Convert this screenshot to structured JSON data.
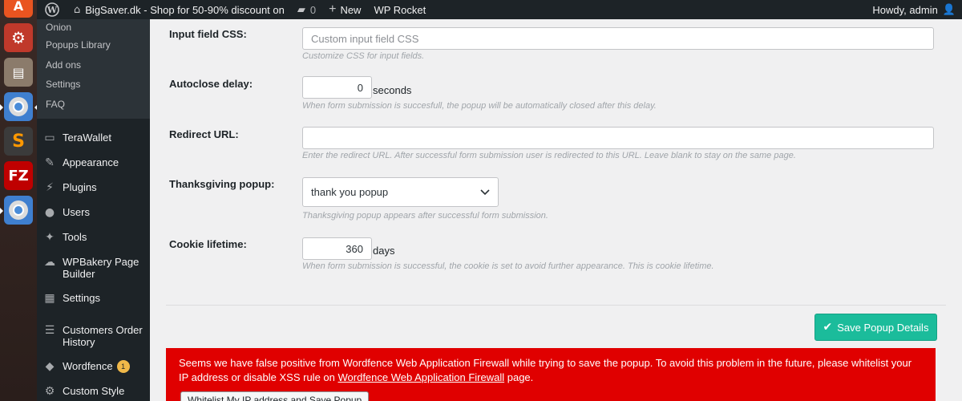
{
  "adminbar": {
    "site_name": "BigSaver.dk - Shop for 50-90% discount on",
    "comments_count": "0",
    "new_label": "New",
    "wp_rocket_label": "WP Rocket",
    "howdy": "Howdy, admin"
  },
  "sidebar": {
    "submenu": [
      "Onion",
      "Popups Library",
      "Add ons",
      "Settings",
      "FAQ"
    ],
    "items": [
      {
        "label": "TeraWallet",
        "icon": "wallet-icon"
      },
      {
        "label": "Appearance",
        "icon": "paintbrush-icon"
      },
      {
        "label": "Plugins",
        "icon": "plug-icon"
      },
      {
        "label": "Users",
        "icon": "user-icon"
      },
      {
        "label": "Tools",
        "icon": "wrench-icon"
      },
      {
        "label": "WPBakery Page Builder",
        "icon": "cloud-icon"
      },
      {
        "label": "Settings",
        "icon": "settings-icon"
      },
      {
        "label": "Customers Order History",
        "icon": "list-icon"
      },
      {
        "label": "Wordfence",
        "icon": "wordfence-icon",
        "badge": "1"
      },
      {
        "label": "Custom Style",
        "icon": "gear-icon"
      }
    ]
  },
  "form": {
    "input_css": {
      "label": "Input field CSS:",
      "placeholder": "Custom input field CSS",
      "help": "Customize CSS for input fields."
    },
    "autoclose": {
      "label": "Autoclose delay:",
      "value": "0",
      "unit": "seconds",
      "help": "When form submission is succesfull, the popup will be automatically closed after this delay."
    },
    "redirect": {
      "label": "Redirect URL:",
      "value": "",
      "help": "Enter the redirect URL. After successful form submission user is redirected to this URL. Leave blank to stay on the same page."
    },
    "thanksgiving": {
      "label": "Thanksgiving popup:",
      "selected": "thank you popup",
      "help": "Thanksgiving popup appears after successful form submission."
    },
    "cookie": {
      "label": "Cookie lifetime:",
      "value": "360",
      "unit": "days",
      "help": "When form submission is successful, the cookie is set to avoid further appearance. This is cookie lifetime."
    }
  },
  "save_button": "Save Popup Details",
  "error": {
    "text_before": "Seems we have false positive from Wordfence Web Application Firewall while trying to save the popup. To avoid this problem in the future, please whitelist your IP address or disable XSS rule on ",
    "link_text": "Wordfence Web Application Firewall",
    "text_after": " page.",
    "whitelist_button": "Whitelist My IP address and Save Popup"
  },
  "colors": {
    "accent": "#1bbc9b",
    "error": "#e00000",
    "admin_bar": "#1d2327"
  }
}
